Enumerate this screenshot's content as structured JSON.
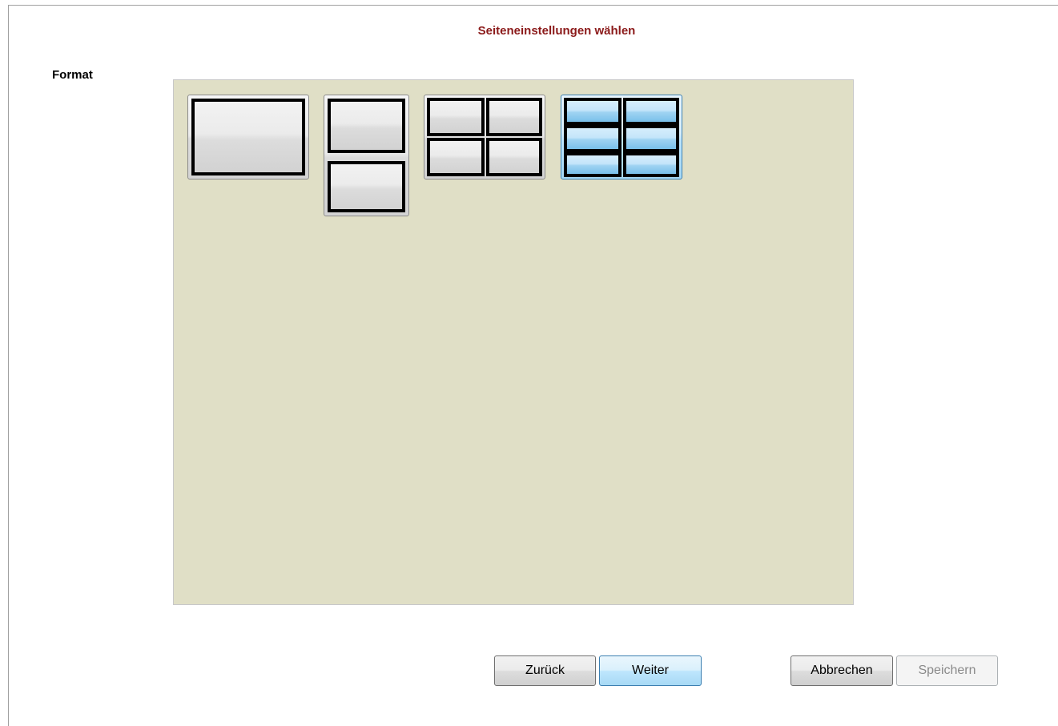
{
  "dialog": {
    "title": "Seiteneinstellungen wählen"
  },
  "format": {
    "label": "Format",
    "options": [
      {
        "name": "1x1 layout",
        "selected": false
      },
      {
        "name": "1x2 layout",
        "selected": false
      },
      {
        "name": "2x2 layout",
        "selected": false
      },
      {
        "name": "2x3 layout",
        "selected": true
      }
    ]
  },
  "buttons": {
    "back": "Zurück",
    "next": "Weiter",
    "cancel": "Abbrechen",
    "save": "Speichern"
  },
  "colors": {
    "title": "#8b1a1a",
    "panel_background": "#e0dfc6",
    "selected_accent": "#3c7fb1"
  }
}
